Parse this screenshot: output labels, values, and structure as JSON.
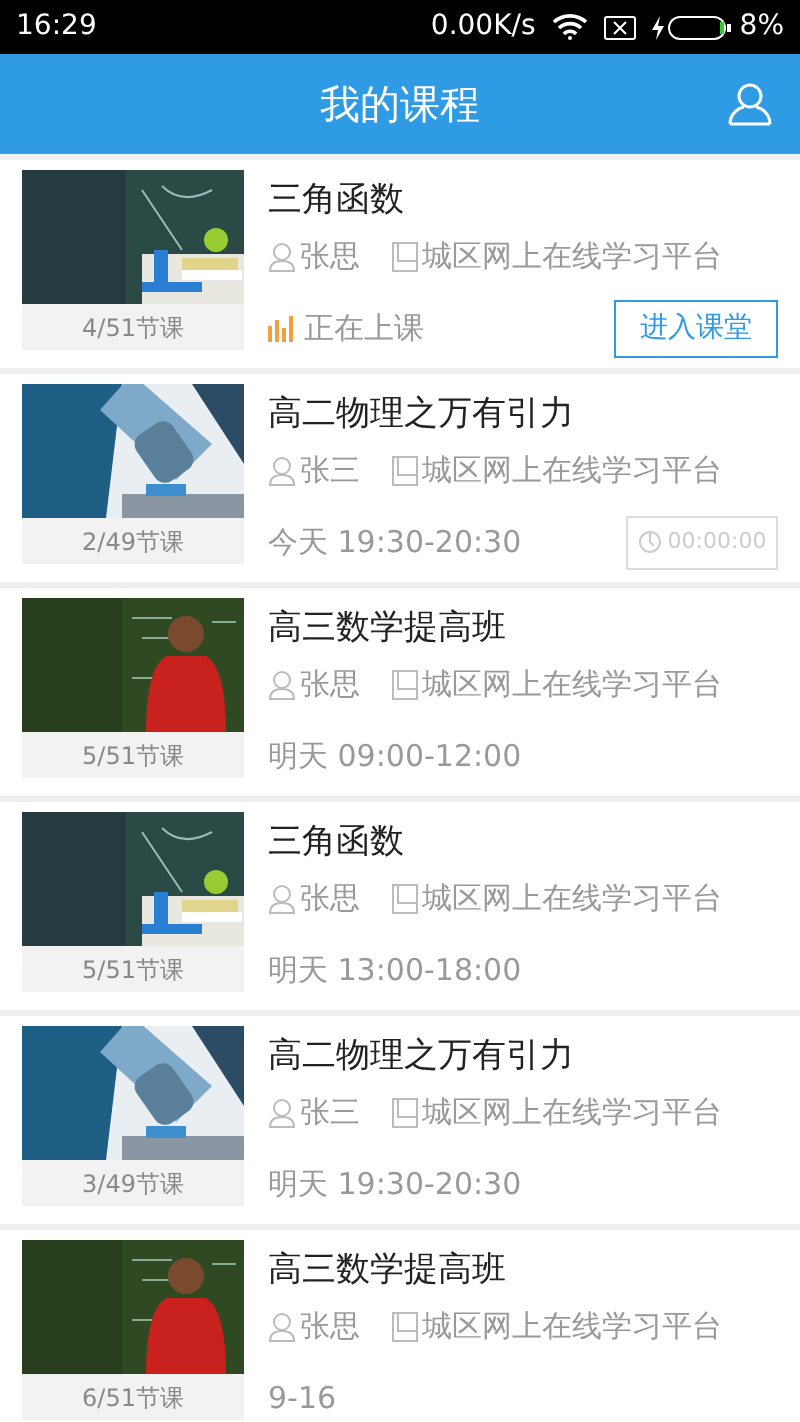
{
  "status_bar": {
    "time": "16:29",
    "speed": "0.00K/s",
    "battery": "8%"
  },
  "header": {
    "title": "我的课程"
  },
  "courses": [
    {
      "kind": "live",
      "title": "三角函数",
      "teacher": "张思",
      "platform": "城区网上在线学习平台",
      "lessons": "4/51节课",
      "status": "正在上课",
      "button": "进入课堂"
    },
    {
      "kind": "countdown",
      "title": "高二物理之万有引力",
      "teacher": "张三",
      "platform": "城区网上在线学习平台",
      "lessons": "2/49节课",
      "status": "今天 19:30-20:30",
      "button": "00:00:00"
    },
    {
      "kind": "scheduled",
      "title": "高三数学提高班",
      "teacher": "张思",
      "platform": "城区网上在线学习平台",
      "lessons": "5/51节课",
      "status": "明天 09:00-12:00"
    },
    {
      "kind": "scheduled",
      "title": "三角函数",
      "teacher": "张思",
      "platform": "城区网上在线学习平台",
      "lessons": "5/51节课",
      "status": "明天 13:00-18:00"
    },
    {
      "kind": "scheduled",
      "title": "高二物理之万有引力",
      "teacher": "张三",
      "platform": "城区网上在线学习平台",
      "lessons": "3/49节课",
      "status": "明天 19:30-20:30"
    },
    {
      "kind": "scheduled",
      "title": "高三数学提高班",
      "teacher": "张思",
      "platform": "城区网上在线学习平台",
      "lessons": "6/51节课",
      "status": "9-16"
    }
  ]
}
